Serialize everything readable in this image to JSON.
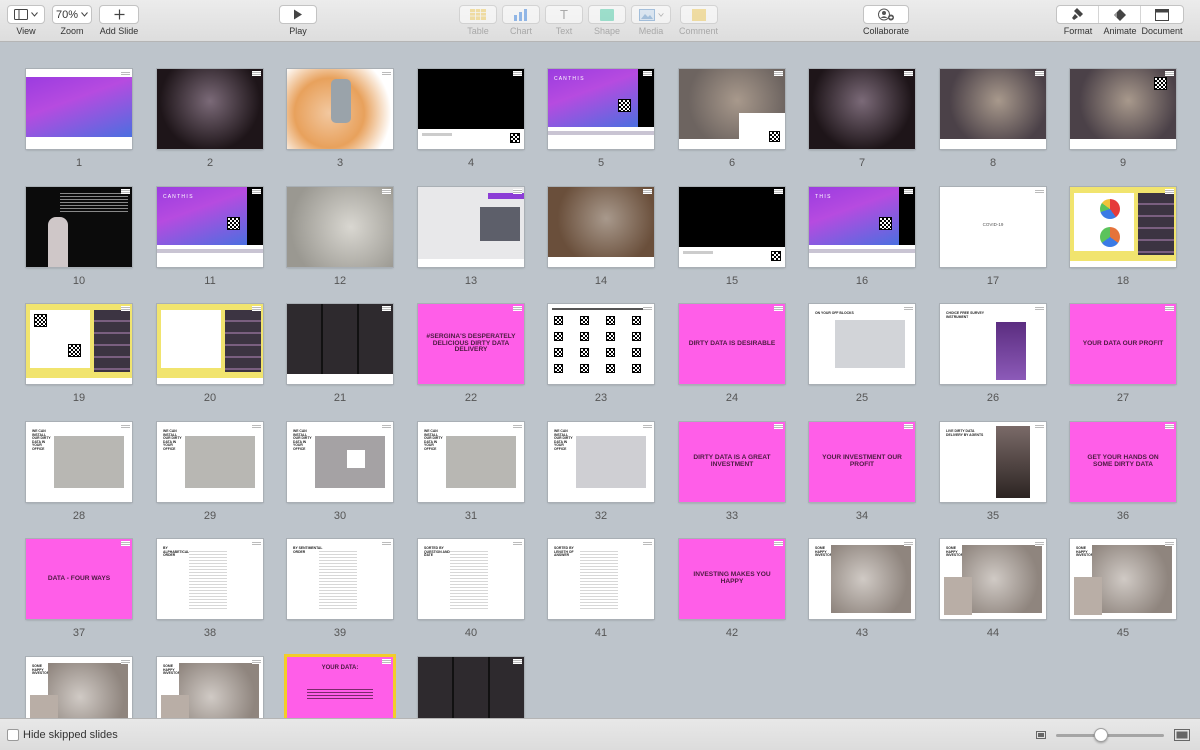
{
  "toolbar": {
    "view_label": "View",
    "zoom_value": "70%",
    "zoom_label": "Zoom",
    "add_slide_label": "Add Slide",
    "play_label": "Play",
    "table_label": "Table",
    "chart_label": "Chart",
    "text_label": "Text",
    "shape_label": "Shape",
    "media_label": "Media",
    "comment_label": "Comment",
    "collaborate_label": "Collaborate",
    "format_label": "Format",
    "animate_label": "Animate",
    "document_label": "Document",
    "text_icon_glyph": "T"
  },
  "slides": [
    {
      "n": "1",
      "kind": "gradient"
    },
    {
      "n": "2",
      "kind": "photo-dark"
    },
    {
      "n": "3",
      "kind": "phone"
    },
    {
      "n": "4",
      "kind": "black",
      "caption": "SHUT THE PHONE OFF"
    },
    {
      "n": "5",
      "kind": "canthis",
      "text": "C A N   T H I S"
    },
    {
      "n": "6",
      "kind": "collage"
    },
    {
      "n": "7",
      "kind": "photo-dark"
    },
    {
      "n": "8",
      "kind": "stage"
    },
    {
      "n": "9",
      "kind": "stage-qr"
    },
    {
      "n": "10",
      "kind": "dark-text"
    },
    {
      "n": "11",
      "kind": "canthis",
      "text": "C A N   T H I S"
    },
    {
      "n": "12",
      "kind": "photo-light"
    },
    {
      "n": "13",
      "kind": "screen"
    },
    {
      "n": "14",
      "kind": "photo-warm"
    },
    {
      "n": "15",
      "kind": "black"
    },
    {
      "n": "16",
      "kind": "canthis",
      "text": "T H I S"
    },
    {
      "n": "17",
      "kind": "plain",
      "text": "COVID-19"
    },
    {
      "n": "18",
      "kind": "zoom-pie"
    },
    {
      "n": "19",
      "kind": "zoom-qr"
    },
    {
      "n": "20",
      "kind": "zoom-list"
    },
    {
      "n": "21",
      "kind": "zoom-grid"
    },
    {
      "n": "22",
      "kind": "pink",
      "text": "#SERGINA'S DESPERATELY DELICIOUS DIRTY DATA DELIVERY"
    },
    {
      "n": "23",
      "kind": "qr-sheet"
    },
    {
      "n": "24",
      "kind": "pink",
      "text": "DIRTY DATA IS DESIRABLE"
    },
    {
      "n": "25",
      "kind": "doc-photo",
      "text": "ON YOUR OFF BLOCKS"
    },
    {
      "n": "26",
      "kind": "survey",
      "text": "CHOICE FREE SURVEY INSTRUMENT"
    },
    {
      "n": "27",
      "kind": "pink",
      "text": "YOUR DATA OUR PROFIT"
    },
    {
      "n": "28",
      "kind": "office",
      "text": "WE CAN INSTALL OUR DIRTY DATA IN YOUR OFFICE"
    },
    {
      "n": "29",
      "kind": "office",
      "text": "WE CAN INSTALL OUR DIRTY DATA IN YOUR OFFICE"
    },
    {
      "n": "30",
      "kind": "office-calendar",
      "text": "WE CAN INSTALL OUR DIRTY DATA IN YOUR OFFICE"
    },
    {
      "n": "31",
      "kind": "office",
      "text": "WE CAN INSTALL OUR DIRTY DATA IN YOUR OFFICE"
    },
    {
      "n": "32",
      "kind": "office-paper",
      "text": "WE CAN INSTALL OUR DIRTY DATA IN YOUR OFFICE"
    },
    {
      "n": "33",
      "kind": "pink",
      "text": "DIRTY DATA IS A GREAT INVESTMENT"
    },
    {
      "n": "34",
      "kind": "pink",
      "text": "YOUR INVESTMENT OUR PROFIT"
    },
    {
      "n": "35",
      "kind": "portrait",
      "text": "LIVE DIRTY DATA DELIVERY BY AGENTS"
    },
    {
      "n": "36",
      "kind": "pink",
      "text": "GET YOUR HANDS ON SOME DIRTY DATA"
    },
    {
      "n": "37",
      "kind": "pink",
      "text": "DATA - FOUR WAYS"
    },
    {
      "n": "38",
      "kind": "table-doc",
      "text": "BY ALPHABETICAL ORDER"
    },
    {
      "n": "39",
      "kind": "table-doc",
      "text": "BY SENTIMENTAL ORDER"
    },
    {
      "n": "40",
      "kind": "table-doc",
      "text": "SORTED BY QUESTION AND DATE"
    },
    {
      "n": "41",
      "kind": "table-doc",
      "text": "SORTED BY LENGTH OF ANSWER"
    },
    {
      "n": "42",
      "kind": "pink",
      "text": "INVESTING MAKES YOU HAPPY"
    },
    {
      "n": "43",
      "kind": "investor1",
      "text": "SOME HAPPY INVESTORS"
    },
    {
      "n": "44",
      "kind": "investor2",
      "text": "SOME HAPPY INVESTORS"
    },
    {
      "n": "45",
      "kind": "investor3",
      "text": "SOME HAPPY INVESTORS"
    },
    {
      "n": "46",
      "kind": "investor4",
      "text": "SOME HAPPY INVESTORS"
    },
    {
      "n": "47",
      "kind": "investor4",
      "text": "SOME HAPPY INVESTORS"
    },
    {
      "n": "48",
      "kind": "pink-selected",
      "text": "YOUR DATA:"
    },
    {
      "n": "49",
      "kind": "zoom-faces"
    }
  ],
  "bottom": {
    "hide_skipped_label": "Hide skipped slides"
  },
  "colors": {
    "pink": "#ff5ee8",
    "gradient_start": "#9b3ce0",
    "gradient_end": "#4b6fe0",
    "selected_border": "#f3cc2a",
    "background": "#bdc4cb"
  }
}
